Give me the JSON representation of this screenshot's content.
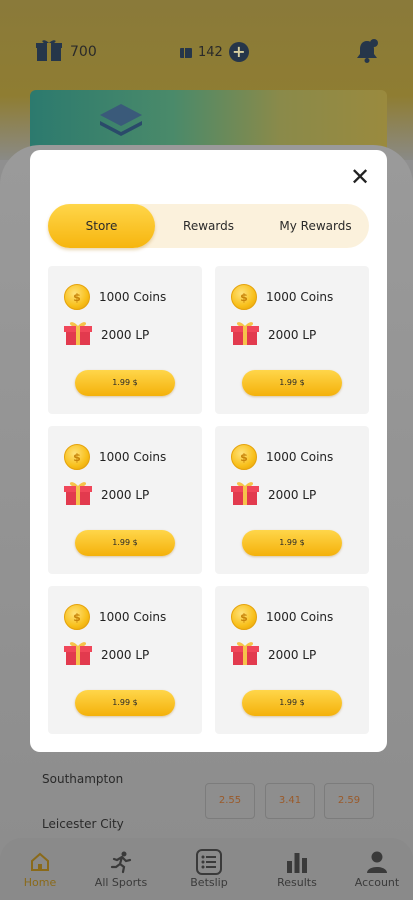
{
  "header": {
    "gift_count": "700",
    "ticket_count": "142",
    "plus_label": "+"
  },
  "background_matches": [
    {
      "team": "Southampton",
      "odds": [
        "2.55",
        "3.41",
        "2.59"
      ]
    },
    {
      "team": "Leicester City"
    }
  ],
  "bottom_nav": [
    {
      "label": "Home",
      "icon": "home-icon",
      "active": true
    },
    {
      "label": "All Sports",
      "icon": "runner-icon",
      "active": false
    },
    {
      "label": "Betslip",
      "icon": "betslip-icon",
      "active": false
    },
    {
      "label": "Results",
      "icon": "bar-chart-icon",
      "active": false
    },
    {
      "label": "Account",
      "icon": "user-icon",
      "active": false
    }
  ],
  "modal": {
    "close_label": "✕",
    "tabs": [
      {
        "label": "Store",
        "active": true
      },
      {
        "label": "Rewards",
        "active": false
      },
      {
        "label": "My Rewards",
        "active": false
      }
    ],
    "packages": [
      {
        "coins": "1000 Coins",
        "lp": "2000 LP",
        "price": "1.99 $"
      },
      {
        "coins": "1000 Coins",
        "lp": "2000 LP",
        "price": "1.99 $"
      },
      {
        "coins": "1000 Coins",
        "lp": "2000 LP",
        "price": "1.99 $"
      },
      {
        "coins": "1000 Coins",
        "lp": "2000 LP",
        "price": "1.99 $"
      },
      {
        "coins": "1000 Coins",
        "lp": "2000 LP",
        "price": "1.99 $"
      },
      {
        "coins": "1000 Coins",
        "lp": "2000 LP",
        "price": "1.99 $"
      }
    ]
  },
  "colors": {
    "accent": "#f6b50e",
    "tab_track": "#fbf1dc",
    "card_bg": "#f3f3f3",
    "overlay": "#8f8f8f"
  }
}
